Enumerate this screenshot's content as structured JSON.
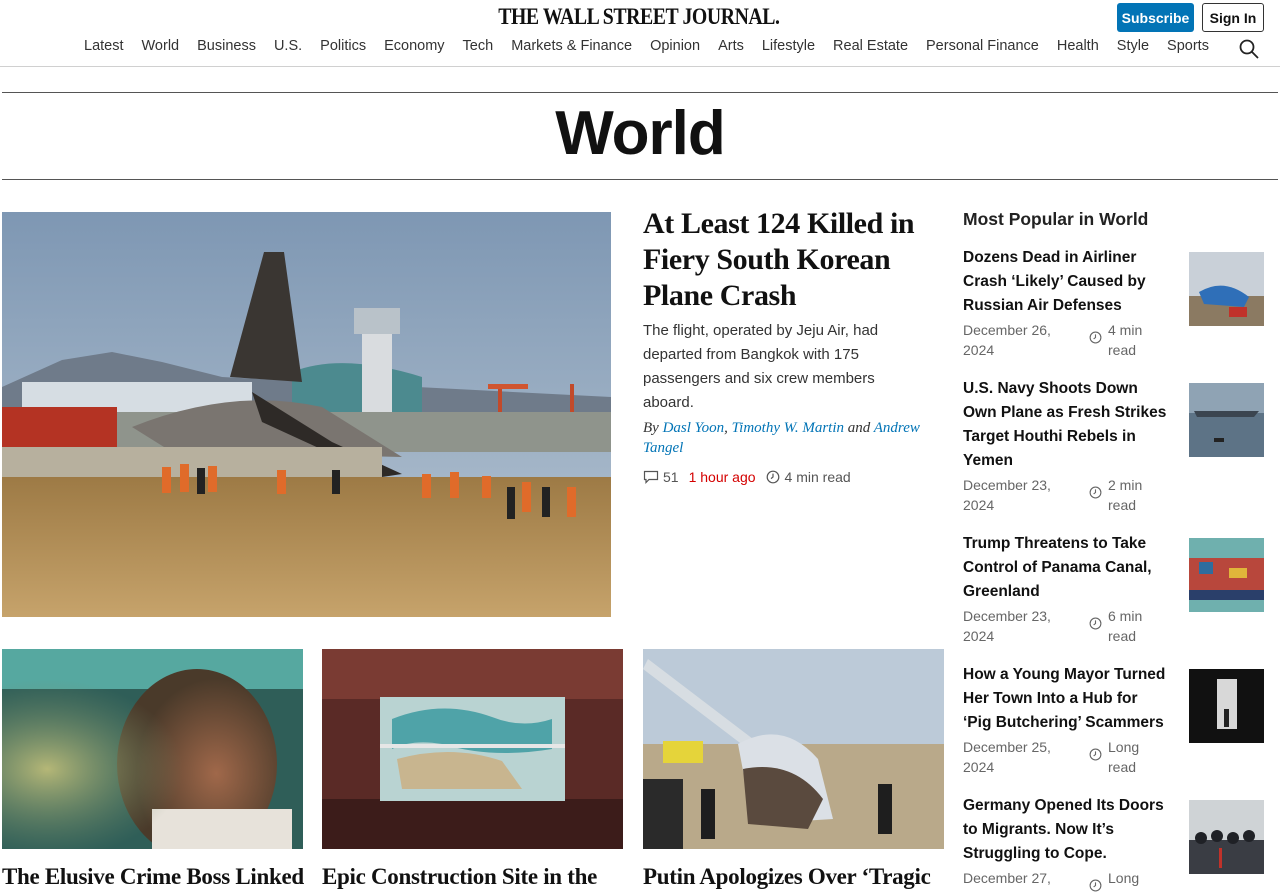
{
  "header": {
    "masthead": "THE WALL STREET JOURNAL.",
    "subscribe_label": "Subscribe",
    "signin_label": "Sign In",
    "nav": [
      "Latest",
      "World",
      "Business",
      "U.S.",
      "Politics",
      "Economy",
      "Tech",
      "Markets & Finance",
      "Opinion",
      "Arts",
      "Lifestyle",
      "Real Estate",
      "Personal Finance",
      "Health",
      "Style",
      "Sports"
    ],
    "search_icon": "search-icon"
  },
  "section": {
    "title": "World"
  },
  "lead": {
    "headline": "At Least 124 Killed in Fiery South Korean Plane Crash",
    "summary": "The flight, operated by Jeju Air, had departed from Bangkok with 175 passengers and six crew members aboard.",
    "byline_prefix": "By",
    "authors": [
      "Dasl Yoon",
      "Timothy W. Martin",
      "Andrew Tangel"
    ],
    "byline_sep": ",",
    "byline_and": "and",
    "comments": "51",
    "time": "1 hour ago",
    "read_time": "4 min read"
  },
  "cards": [
    {
      "headline": "The Elusive Crime Boss Linked"
    },
    {
      "headline": "Epic Construction Site in the"
    },
    {
      "headline": "Putin Apologizes Over ‘Tragic"
    }
  ],
  "popular": {
    "title": "Most Popular in World",
    "items": [
      {
        "headline": "Dozens Dead in Airliner Crash ‘Likely’ Caused by Russian Air Defenses",
        "date": "December 26, 2024",
        "read": "4 min read"
      },
      {
        "headline": "U.S. Navy Shoots Down Own Plane as Fresh Strikes Target Houthi Rebels in Yemen",
        "date": "December 23, 2024",
        "read": "2 min read"
      },
      {
        "headline": "Trump Threatens to Take Control of Panama Canal, Greenland",
        "date": "December 23, 2024",
        "read": "6 min read"
      },
      {
        "headline": "How a Young Mayor Turned Her Town Into a Hub for ‘Pig Butchering’ Scammers",
        "date": "December 25, 2024",
        "read": "Long read"
      },
      {
        "headline": "Germany Opened Its Doors to Migrants. Now It’s Struggling to Cope.",
        "date": "December 27,",
        "read": "Long"
      }
    ]
  },
  "colors": {
    "accent": "#0274b6",
    "time_red": "#d40000"
  }
}
